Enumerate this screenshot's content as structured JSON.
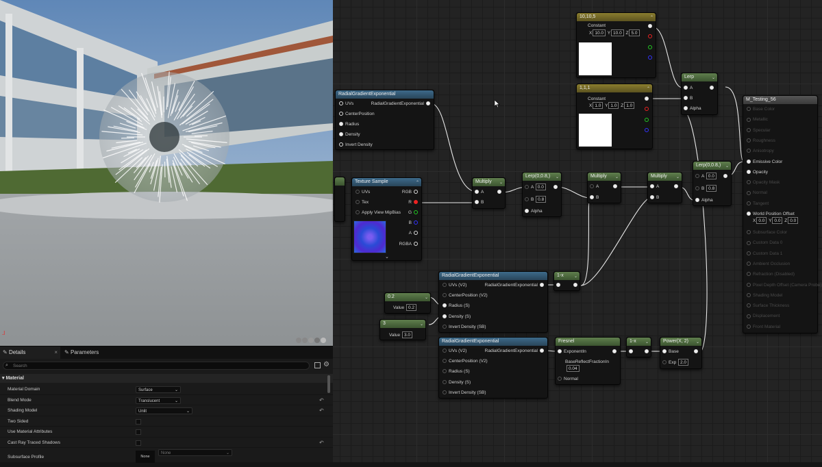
{
  "details": {
    "tab_details": "Details",
    "tab_parameters": "Parameters",
    "search_placeholder": "Search",
    "section": "Material",
    "rows": [
      {
        "label": "Material Domain",
        "value": "Surface"
      },
      {
        "label": "Blend Mode",
        "value": "Translucent"
      },
      {
        "label": "Shading Model",
        "value": "Unlit"
      },
      {
        "label": "Two Sided"
      },
      {
        "label": "Use Material Attributes"
      },
      {
        "label": "Cast Ray Traced Shadows"
      },
      {
        "label": "Subsurface Profile",
        "value": "None",
        "extra": "None"
      }
    ]
  },
  "nodes": {
    "rge1": {
      "title": "RadialGradientExponential",
      "uvs": "UVs",
      "center": "CenterPosition",
      "radius": "Radius",
      "density": "Density",
      "invert": "Invert Density",
      "out": "RadialGradientExponential"
    },
    "tex": {
      "title": "Texture Sample",
      "uvs": "UVs",
      "tex": "Tex",
      "mip": "Apply View MipBias",
      "rgb": "RGB",
      "r": "R",
      "g": "G",
      "b": "B",
      "a": "A",
      "rgba": "RGBA"
    },
    "const3a": {
      "title": "10,10,5",
      "label": "Constant",
      "x": "10.0",
      "y": "10.0",
      "z": "5.0"
    },
    "const3b": {
      "title": "1,1,1",
      "label": "Constant",
      "x": "1.0",
      "y": "1.0",
      "z": "1.0"
    },
    "lerp_top": {
      "title": "Lerp",
      "a": "A",
      "b": "B",
      "alpha": "Alpha"
    },
    "mult1": {
      "title": "Multiply",
      "a": "A",
      "b": "B"
    },
    "lerp1": {
      "title": "Lerp(0,0.8,)",
      "a": "A",
      "av": "0.0",
      "b": "B",
      "bv": "0.8",
      "alpha": "Alpha"
    },
    "mult2": {
      "title": "Multiply",
      "a": "A",
      "b": "B"
    },
    "mult3": {
      "title": "Multiply",
      "a": "A",
      "b": "B"
    },
    "lerp2": {
      "title": "Lerp(0,0.8,)",
      "a": "A",
      "av": "0.0",
      "b": "B",
      "bv": "0.8",
      "alpha": "Alpha"
    },
    "oneminus1": {
      "title": "1-x"
    },
    "rge2": {
      "title": "RadialGradientExponential",
      "uvs": "UVs (V2)",
      "center": "CenterPosition (V2)",
      "radius": "Radius (S)",
      "density": "Density (S)",
      "invert": "Invert Density (SB)",
      "out": "RadialGradientExponential"
    },
    "rge3": {
      "title": "RadialGradientExponential",
      "uvs": "UVs (V2)",
      "center": "CenterPosition (V2)",
      "radius": "Radius (S)",
      "density": "Density (S)",
      "invert": "Invert Density (SB)",
      "out": "RadialGradientExponential"
    },
    "c02": {
      "title": "0.2",
      "label": "Value",
      "value": "0.2"
    },
    "c3": {
      "title": "3",
      "label": "Value",
      "value": "3.0"
    },
    "fresnel": {
      "title": "Fresnel",
      "exp": "ExponentIn",
      "base": "BaseReflectFractionIn",
      "base_val": "0.04",
      "normal": "Normal"
    },
    "oneminus2": {
      "title": "1-x"
    },
    "power": {
      "title": "Power(X, 2)",
      "base": "Base",
      "exp": "Exp",
      "exp_val": "2.0"
    },
    "mat": {
      "title": "M_Testing_56",
      "pins": [
        "Base Color",
        "Metallic",
        "Specular",
        "Roughness",
        "Anisotropy",
        "Emissive Color",
        "Opacity",
        "Opacity Mask",
        "Normal",
        "Tangent",
        "World Position Offset",
        "Subsurface Color",
        "Custom Data 0",
        "Custom Data 1",
        "Ambient Occlusion",
        "Refraction (Disabled)",
        "Pixel Depth Offset (Camera Probe)",
        "Shading Model",
        "Surface Thickness",
        "Displacement",
        "Front Material"
      ],
      "wpo_x": "0.0",
      "wpo_y": "0.0",
      "wpo_z": "0.0"
    }
  }
}
